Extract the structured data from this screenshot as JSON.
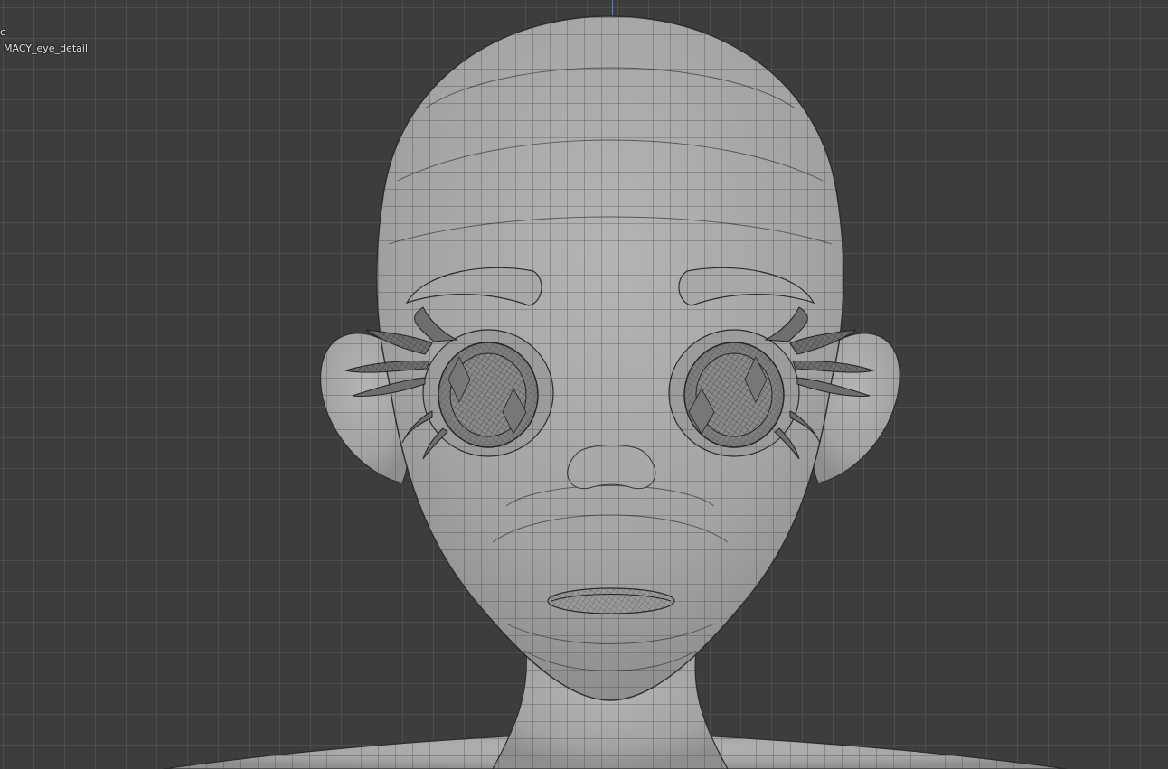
{
  "viewport": {
    "view_mode_text": "c",
    "object_name": "MACY_eye_detail"
  },
  "colors": {
    "background": "#3d3d3d",
    "grid": "#5a5a5a",
    "mesh_fill": "#a6a6a6",
    "wire": "#2f2f2f",
    "axis_z": "#4f7fd0"
  },
  "icons": {
    "model": "3d-head-mesh"
  }
}
